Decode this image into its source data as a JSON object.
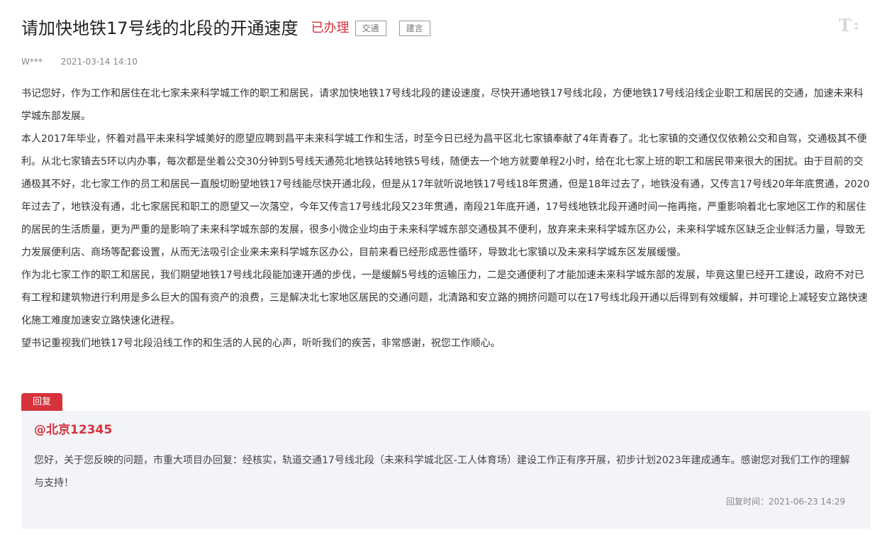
{
  "header": {
    "title": "请加快地铁17号线的北段的开通速度",
    "status": "已办理",
    "tags": [
      "交通",
      "建言"
    ],
    "font_toggle_icon": "font-size-toggle-icon"
  },
  "meta": {
    "author": "W***",
    "datetime": "2021-03-14 14:10"
  },
  "content": {
    "paragraphs": [
      "书记您好，作为工作和居住在北七家未来科学城工作的职工和居民，请求加快地铁17号线北段的建设速度，尽快开通地铁17号线北段，方便地铁17号线沿线企业职工和居民的交通，加速未来科学城东部发展。",
      "本人2017年毕业，怀着对昌平未来科学城美好的愿望应聘到昌平未来科学城工作和生活，时至今日已经为昌平区北七家镇奉献了4年青春了。北七家镇的交通仅仅依赖公交和自驾，交通极其不便利。从北七家镇去5环以内办事，每次都是坐着公交30分钟到5号线天通苑北地铁站转地铁5号线，随便去一个地方就要单程2小时，给在北七家上班的职工和居民带来很大的困扰。由于目前的交通极其不好，北七家工作的员工和居民一直殷切盼望地铁17号线能尽快开通北段，但是从17年就听说地铁17号线18年贯通，但是18年过去了，地铁没有通，又传言17号线20年年底贯通，2020年过去了，地铁没有通，北七家居民和职工的愿望又一次落空，今年又传言17号线北段又23年贯通，南段21年底开通，17号线地铁北段开通时间一拖再拖，严重影响着北七家地区工作的和居住的居民的生活质量，更为严重的是影响了未来科学城东部的发展，很多小微企业均由于未来科学城东部交通极其不便利，放弃来未来科学城东区办公，未来科学城东区缺乏企业鲜活力量，导致无力发展便利店、商场等配套设置，从而无法吸引企业来未来科学城东区办公，目前来看已经形成恶性循环，导致北七家镇以及未来科学城东区发展缓慢。",
      "作为北七家工作的职工和居民，我们期望地铁17号线北段能加速开通的步伐，一是缓解5号线的运输压力，二是交通便利了才能加速未来科学城东部的发展，毕竟这里已经开工建设，政府不对已有工程和建筑物进行利用是多么巨大的国有资产的浪费，三是解决北七家地区居民的交通问题，北清路和安立路的拥挤问题可以在17号线北段开通以后得到有效缓解，并可理论上减轻安立路快速化施工难度加速安立路快速化进程。",
      "望书记重视我们地铁17号北段沿线工作的和生活的人民的心声，听听我们的疾苦，非常感谢，祝您工作顺心。"
    ]
  },
  "reply": {
    "label": "回复",
    "org": "@北京12345",
    "text": "您好，关于您反映的问题，市重大项目办回复：经核实，轨道交通17号线北段（未来科学城北区-工人体育场）建设工作正有序开展，初步计划2023年建成通车。感谢您对我们工作的理解与支持！",
    "time": "回复时间：2021-06-23 14:29"
  },
  "colors": {
    "accent": "#d6333c",
    "reply_bg": "#f3f4f8",
    "text": "#333333",
    "muted": "#888888"
  }
}
